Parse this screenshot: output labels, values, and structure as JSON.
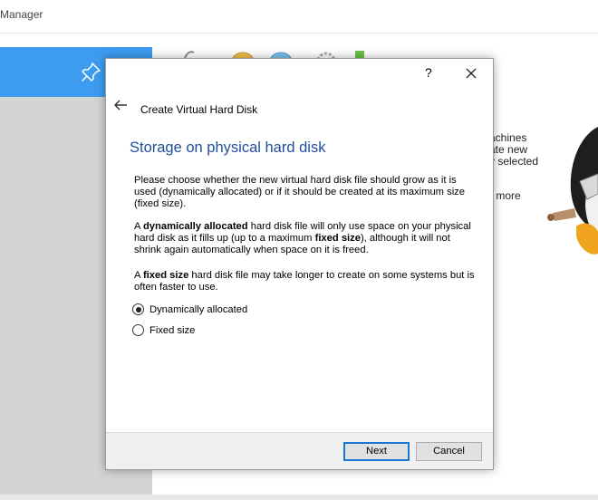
{
  "main_window": {
    "title_fragment": "Manager",
    "right_text_lines": [
      "achines",
      "ate new",
      "y selected",
      "r more"
    ]
  },
  "dialog": {
    "help_label": "?",
    "header": "Create Virtual Hard Disk",
    "heading": "Storage on physical hard disk",
    "paragraph1": "Please choose whether the new virtual hard disk file should grow as it is used (dynamically allocated) or if it should be created at its maximum size (fixed size).",
    "paragraph2": {
      "p1": "A ",
      "b1": "dynamically allocated",
      "p2": " hard disk file will only use space on your physical hard disk as it fills up (up to a maximum ",
      "b2": "fixed size",
      "p3": "), although it will not shrink again automatically when space on it is freed."
    },
    "paragraph3": {
      "p1": "A ",
      "b1": "fixed size",
      "p2": " hard disk file may take longer to create on some systems but is often faster to use."
    },
    "options": [
      {
        "label": "Dynamically allocated",
        "checked": true
      },
      {
        "label": "Fixed size",
        "checked": false
      }
    ],
    "buttons": {
      "next": "Next",
      "cancel": "Cancel"
    }
  },
  "colors": {
    "heading": "#1f4e9a",
    "selection": "#3d9cf0",
    "default_button_border": "#1976d2"
  },
  "icons": [
    "pin-icon",
    "back-arrow-icon",
    "close-icon",
    "tux-icon"
  ]
}
